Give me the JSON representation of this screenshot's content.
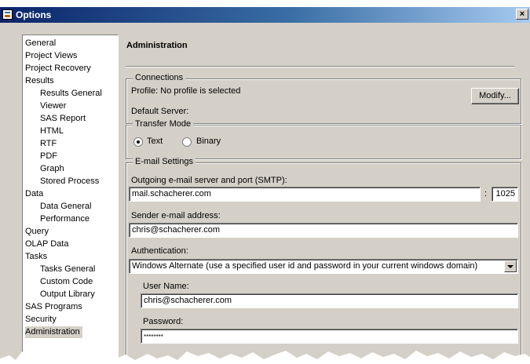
{
  "window": {
    "title": "Options",
    "close_glyph": "×"
  },
  "nav": {
    "items": [
      {
        "label": "General",
        "level": 0
      },
      {
        "label": "Project Views",
        "level": 0
      },
      {
        "label": "Project Recovery",
        "level": 0
      },
      {
        "label": "Results",
        "level": 0
      },
      {
        "label": "Results General",
        "level": 1
      },
      {
        "label": "Viewer",
        "level": 1
      },
      {
        "label": "SAS Report",
        "level": 1
      },
      {
        "label": "HTML",
        "level": 1
      },
      {
        "label": "RTF",
        "level": 1
      },
      {
        "label": "PDF",
        "level": 1
      },
      {
        "label": "Graph",
        "level": 1
      },
      {
        "label": "Stored Process",
        "level": 1
      },
      {
        "label": "Data",
        "level": 0
      },
      {
        "label": "Data General",
        "level": 1
      },
      {
        "label": "Performance",
        "level": 1
      },
      {
        "label": "Query",
        "level": 0
      },
      {
        "label": "OLAP Data",
        "level": 0
      },
      {
        "label": "Tasks",
        "level": 0
      },
      {
        "label": "Tasks General",
        "level": 1
      },
      {
        "label": "Custom Code",
        "level": 1
      },
      {
        "label": "Output Library",
        "level": 1
      },
      {
        "label": "SAS Programs",
        "level": 0
      },
      {
        "label": "Security",
        "level": 0
      },
      {
        "label": "Administration",
        "level": 0,
        "selected": true
      }
    ]
  },
  "panel": {
    "title": "Administration"
  },
  "connections": {
    "legend": "Connections",
    "profile_text": "Profile: No profile is selected",
    "modify_label": "Modify...",
    "default_server_label": "Default Server:"
  },
  "transfer_mode": {
    "legend": "Transfer Mode",
    "text_label": "Text",
    "binary_label": "Binary",
    "selected": "Text"
  },
  "email": {
    "legend": "E-mail Settings",
    "smtp_label": "Outgoing e-mail server and port (SMTP):",
    "smtp_server": "mail.schacherer.com",
    "port_separator": ":",
    "smtp_port": "1025",
    "sender_label": "Sender e-mail address:",
    "sender_value": "chris@schacherer.com",
    "auth_label": "Authentication:",
    "auth_value": "Windows Alternate (use a specified user id and password in your current windows domain)",
    "username_label": "User Name:",
    "username_value": "chris@schacherer.com",
    "password_label": "Password:",
    "password_value": "********"
  },
  "colors": {
    "dialog_bg": "#d4d0c8",
    "title_start": "#0a246a",
    "title_end": "#a6caf0"
  }
}
